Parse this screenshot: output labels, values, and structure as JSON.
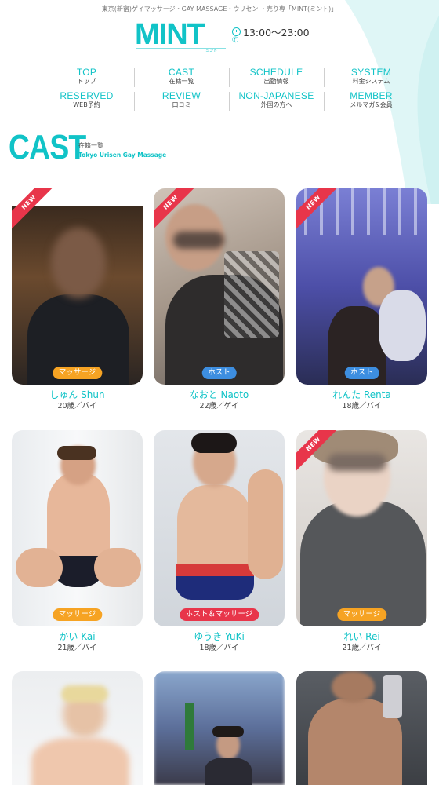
{
  "header": {
    "topline": "東京(新宿)ゲイマッサージ・GAY MASSAGE・ウリセン ・売り専「MINT(ミント)」",
    "logo_text": "MINT",
    "logo_sub": "ミント",
    "hours": "13:00〜23:00",
    "phone_icon": "phone-icon"
  },
  "nav": {
    "rows": [
      [
        {
          "en": "TOP",
          "jp": "トップ"
        },
        {
          "en": "CAST",
          "jp": "在籍一覧"
        },
        {
          "en": "SCHEDULE",
          "jp": "出勤情報"
        },
        {
          "en": "SYSTEM",
          "jp": "料金システム"
        }
      ],
      [
        {
          "en": "RESERVED",
          "jp": "WEB予約"
        },
        {
          "en": "REVIEW",
          "jp": "口コミ"
        },
        {
          "en": "NON-JAPANESE",
          "jp": "外国の方へ"
        },
        {
          "en": "MEMBER",
          "jp": "メルマガ&会員"
        }
      ]
    ]
  },
  "section": {
    "title": "CAST",
    "sub_jp": "在籍一覧",
    "sub_en": "Tokyo Urisen Gay Massage"
  },
  "cast": [
    {
      "name": "しゅん Shun",
      "meta": "20歳／バイ",
      "tag": "マッサージ",
      "tag_color": "#f6a323",
      "new": "NEW"
    },
    {
      "name": "なおと Naoto",
      "meta": "22歳／ゲイ",
      "tag": "ホスト",
      "tag_color": "#3d8ee0",
      "new": "NEW"
    },
    {
      "name": "れんた Renta",
      "meta": "18歳／バイ",
      "tag": "ホスト",
      "tag_color": "#3d8ee0",
      "new": "NEW"
    },
    {
      "name": "かい Kai",
      "meta": "21歳／バイ",
      "tag": "マッサージ",
      "tag_color": "#f6a323",
      "new": ""
    },
    {
      "name": "ゆうき YuKi",
      "meta": "18歳／バイ",
      "tag": "ホスト＆マッサージ",
      "tag_color": "#e8354a",
      "new": ""
    },
    {
      "name": "れい Rei",
      "meta": "21歳／バイ",
      "tag": "マッサージ",
      "tag_color": "#f6a323",
      "new": "NEW"
    },
    {
      "name": "",
      "meta": "",
      "tag": "",
      "tag_color": "",
      "new": ""
    },
    {
      "name": "",
      "meta": "",
      "tag": "",
      "tag_color": "",
      "new": ""
    },
    {
      "name": "",
      "meta": "",
      "tag": "",
      "tag_color": "",
      "new": ""
    }
  ],
  "colors": {
    "accent": "#11c3c7",
    "new_badge": "#e8354a",
    "tag_massage": "#f6a323",
    "tag_host": "#3d8ee0",
    "tag_both": "#e8354a"
  }
}
